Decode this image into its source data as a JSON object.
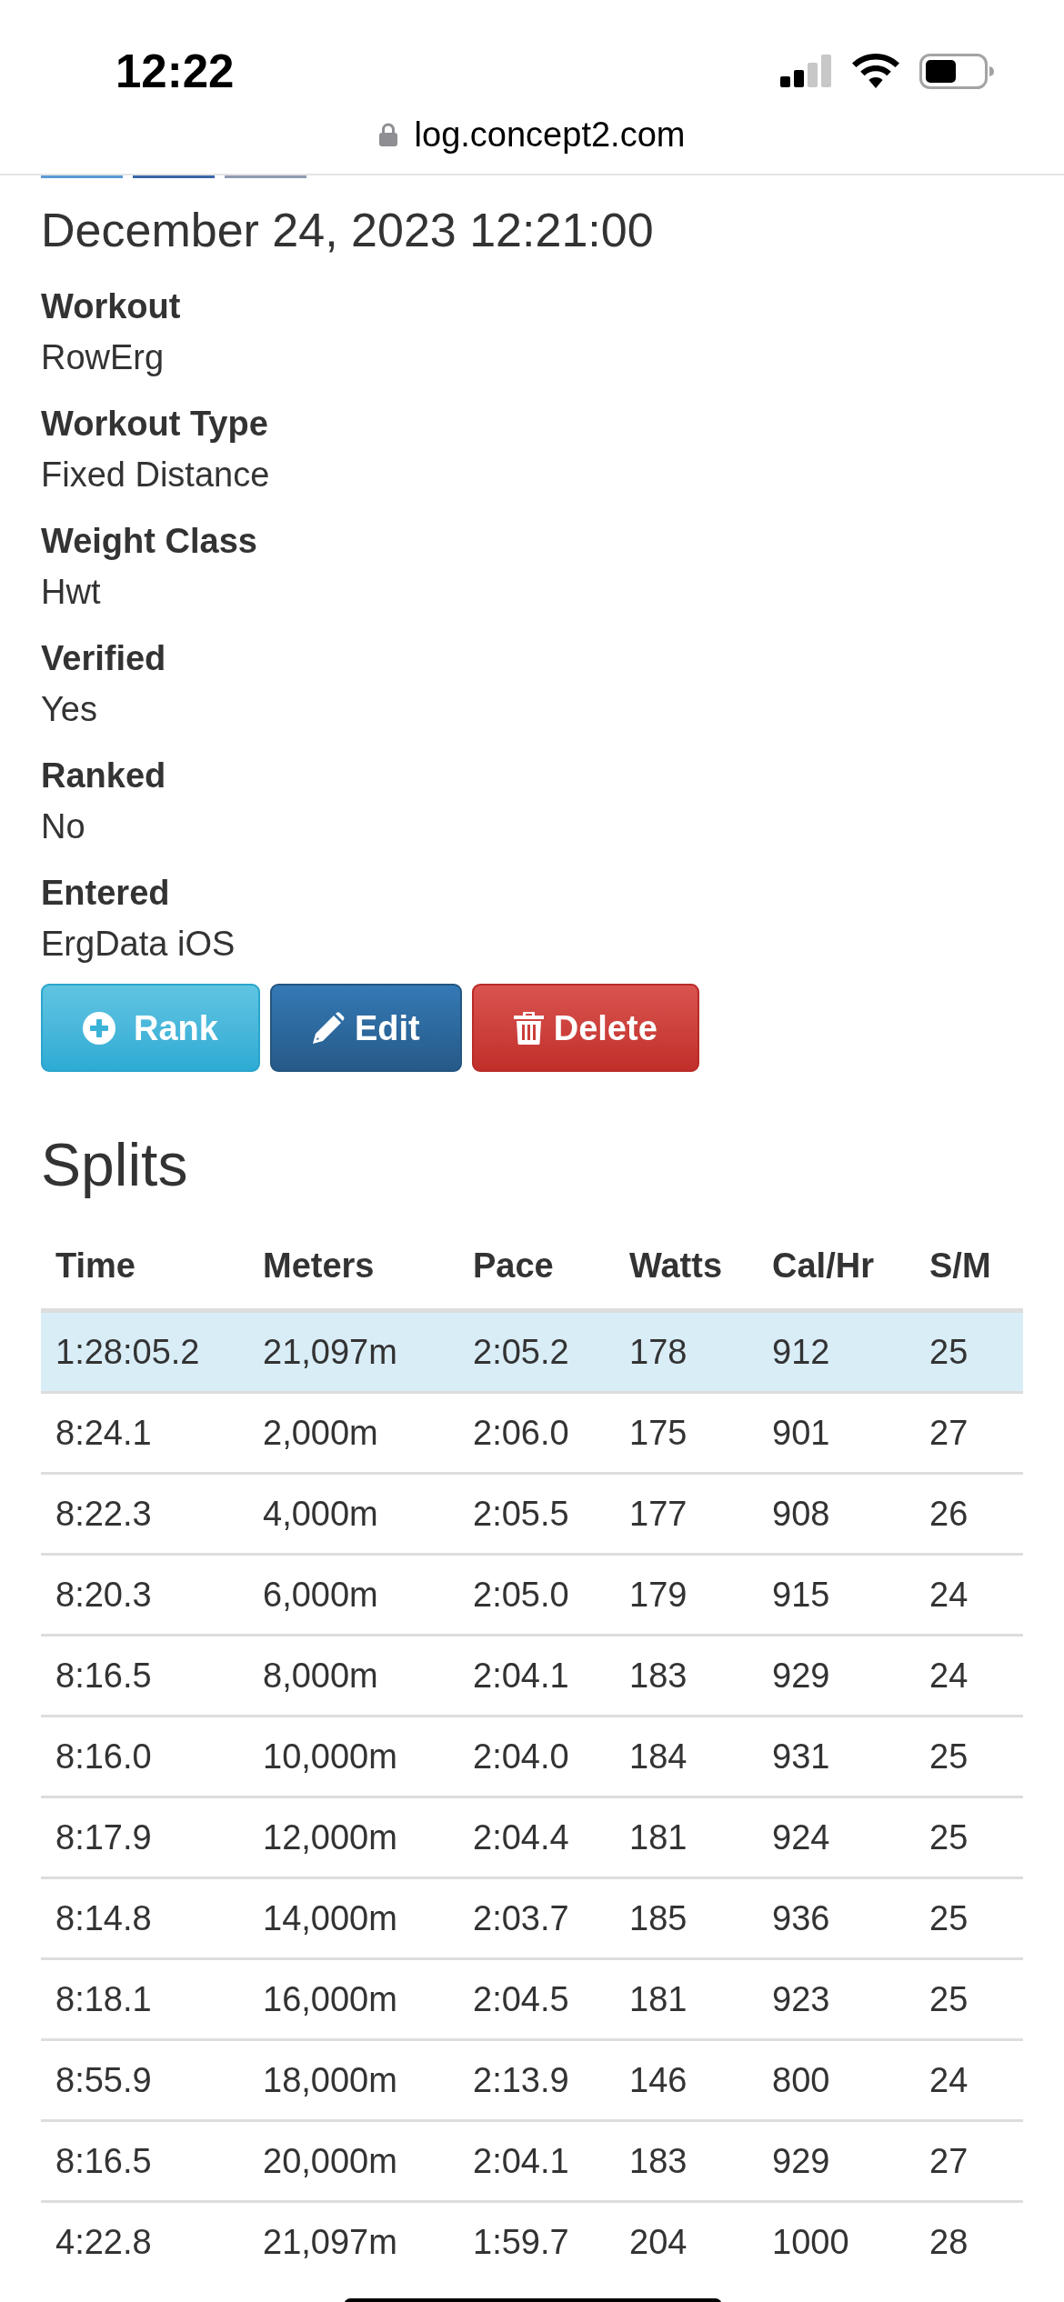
{
  "status_bar": {
    "time": "12:22"
  },
  "address_bar": {
    "url": "log.concept2.com"
  },
  "workout": {
    "title": "December 24, 2023 12:21:00",
    "details": [
      {
        "label": "Workout",
        "value": "RowErg"
      },
      {
        "label": "Workout Type",
        "value": "Fixed Distance"
      },
      {
        "label": "Weight Class",
        "value": "Hwt"
      },
      {
        "label": "Verified",
        "value": "Yes"
      },
      {
        "label": "Ranked",
        "value": "No"
      },
      {
        "label": "Entered",
        "value": "ErgData iOS"
      }
    ]
  },
  "actions": [
    {
      "label": "Rank",
      "kind": "rank"
    },
    {
      "label": "Edit",
      "kind": "edit"
    },
    {
      "label": "Delete",
      "kind": "delete"
    }
  ],
  "splits": {
    "heading": "Splits",
    "columns": [
      "Time",
      "Meters",
      "Pace",
      "Watts",
      "Cal/Hr",
      "S/M"
    ],
    "rows": [
      {
        "kind": "total",
        "cells": [
          "1:28:05.2",
          "21,097m",
          "2:05.2",
          "178",
          "912",
          "25"
        ]
      },
      {
        "kind": "split",
        "cells": [
          "8:24.1",
          "2,000m",
          "2:06.0",
          "175",
          "901",
          "27"
        ]
      },
      {
        "kind": "split",
        "cells": [
          "8:22.3",
          "4,000m",
          "2:05.5",
          "177",
          "908",
          "26"
        ]
      },
      {
        "kind": "split",
        "cells": [
          "8:20.3",
          "6,000m",
          "2:05.0",
          "179",
          "915",
          "24"
        ]
      },
      {
        "kind": "split",
        "cells": [
          "8:16.5",
          "8,000m",
          "2:04.1",
          "183",
          "929",
          "24"
        ]
      },
      {
        "kind": "split",
        "cells": [
          "8:16.0",
          "10,000m",
          "2:04.0",
          "184",
          "931",
          "25"
        ]
      },
      {
        "kind": "split",
        "cells": [
          "8:17.9",
          "12,000m",
          "2:04.4",
          "181",
          "924",
          "25"
        ]
      },
      {
        "kind": "split",
        "cells": [
          "8:14.8",
          "14,000m",
          "2:03.7",
          "185",
          "936",
          "25"
        ]
      },
      {
        "kind": "split",
        "cells": [
          "8:18.1",
          "16,000m",
          "2:04.5",
          "181",
          "923",
          "25"
        ]
      },
      {
        "kind": "split",
        "cells": [
          "8:55.9",
          "18,000m",
          "2:13.9",
          "146",
          "800",
          "24"
        ]
      },
      {
        "kind": "split",
        "cells": [
          "8:16.5",
          "20,000m",
          "2:04.1",
          "183",
          "929",
          "27"
        ]
      },
      {
        "kind": "split",
        "cells": [
          "4:22.8",
          "21,097m",
          "1:59.7",
          "204",
          "1000",
          "28"
        ]
      }
    ]
  }
}
